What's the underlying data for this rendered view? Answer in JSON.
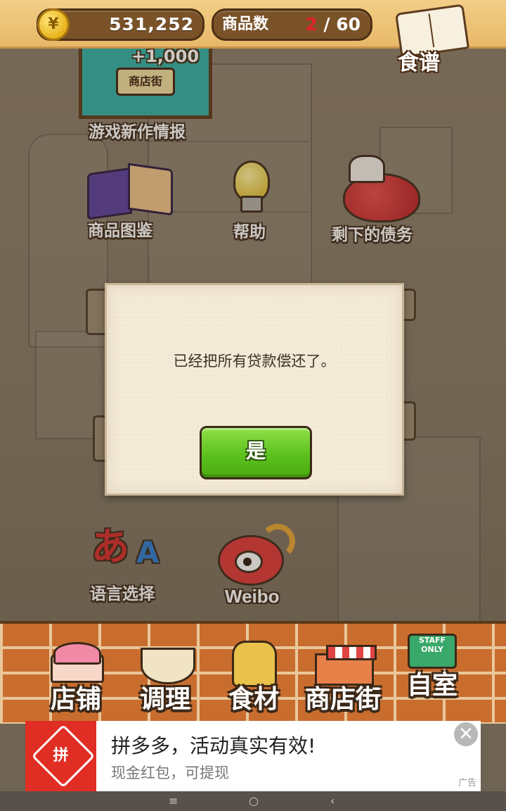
{
  "status_bar": {
    "currency_symbol": "¥",
    "coins": "531,252",
    "goods_label": "商品数",
    "goods_current": "2",
    "goods_separator": "/",
    "goods_max": "60",
    "recipe_label": "食谱"
  },
  "menu": {
    "news_banner_plus": "+1,000",
    "news_banner_logo": "商店街",
    "news_label": "游戏新作情报",
    "catalog_label": "商品图鉴",
    "help_label": "帮助",
    "debt_label": "剩下的债务",
    "language_label": "语言选择",
    "language_glyph_a": "あ",
    "language_glyph_A": "A",
    "weibo_label": "Weibo"
  },
  "dialog": {
    "message": "已经把所有贷款偿还了。",
    "yes_label": "是"
  },
  "bottom_nav": {
    "items": [
      {
        "label": "店铺"
      },
      {
        "label": "调理"
      },
      {
        "label": "食材"
      },
      {
        "label": "商店街"
      },
      {
        "label": "自室"
      }
    ],
    "room_sign": "STAFF ONLY"
  },
  "ad": {
    "logo_text": "拼",
    "title": "拼多多，活动真实有效!",
    "subtitle": "现金红包，可提现",
    "tag": "广告",
    "close_glyph": "✕"
  },
  "system_nav": {
    "menu_glyph": "≡",
    "home_glyph": "○",
    "back_glyph": "‹"
  },
  "colors": {
    "accent_green": "#5cc21e",
    "goods_current_red": "#e0222a",
    "ad_brand_red": "#e02e24"
  }
}
